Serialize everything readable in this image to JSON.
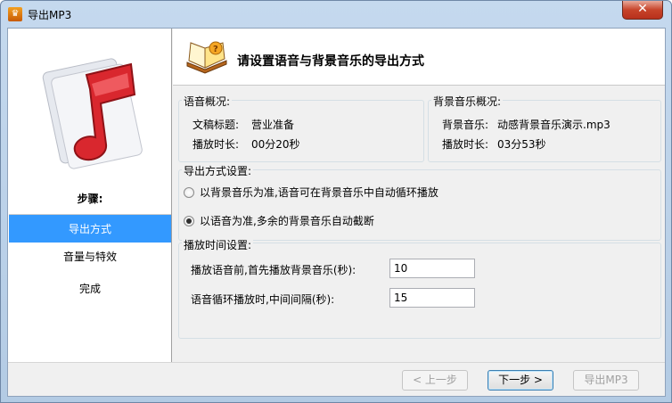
{
  "window": {
    "title": "导出MP3",
    "close_label": "✕"
  },
  "steps": {
    "heading": "步骤:",
    "items": [
      {
        "label": "导出方式",
        "active": true
      },
      {
        "label": "音量与特效",
        "active": false
      },
      {
        "label": "完成",
        "active": false
      }
    ]
  },
  "header": {
    "title": "请设置语音与背景音乐的导出方式"
  },
  "speech_overview": {
    "group_label": "语音概况:",
    "doc_title_label": "文稿标题:",
    "doc_title_value": "营业准备",
    "duration_label": "播放时长:",
    "duration_value": "00分20秒"
  },
  "music_overview": {
    "group_label": "背景音乐概况:",
    "music_label": "背景音乐:",
    "music_value": "动感背景音乐演示.mp3",
    "duration_label": "播放时长:",
    "duration_value": "03分53秒"
  },
  "export_mode": {
    "group_label": "导出方式设置:",
    "options": [
      {
        "label": "以背景音乐为准,语音可在背景音乐中自动循环播放",
        "checked": false
      },
      {
        "label": "以语音为准,多余的背景音乐自动截断",
        "checked": true
      }
    ]
  },
  "timing": {
    "group_label": "播放时间设置:",
    "pre_label": "播放语音前,首先播放背景音乐(秒):",
    "pre_value": "10",
    "interval_label": "语音循环播放时,中间间隔(秒):",
    "interval_value": "15"
  },
  "buttons": {
    "prev": "< 上一步",
    "next": "下一步 >",
    "export": "导出MP3"
  },
  "colors": {
    "active_step": "#3399ff",
    "accent_red": "#d9272e"
  },
  "icons": {
    "logo": "music-note-icon",
    "header": "book-icon",
    "app": "app-icon"
  }
}
